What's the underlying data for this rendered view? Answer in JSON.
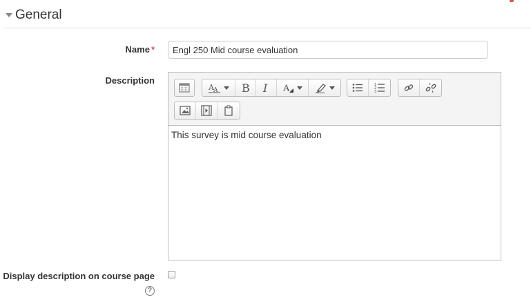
{
  "section": {
    "title": "General"
  },
  "form": {
    "name_label": "Name",
    "required_mark": "*",
    "name_value": "Engl 250 Mid course evaluation",
    "description_label": "Description",
    "description_text": "This survey is mid course evaluation",
    "display_label": "Display description on course page",
    "display_checked": false,
    "help_glyph": "?"
  },
  "toolbar": {
    "row1": [
      {
        "group": [
          {
            "icon": "toolbar-toggle-icon"
          }
        ]
      },
      {
        "group": [
          {
            "icon": "font-style-icon",
            "dropdown": true
          },
          {
            "icon": "bold-icon"
          },
          {
            "icon": "italic-icon"
          },
          {
            "icon": "text-color-icon",
            "dropdown": true
          },
          {
            "icon": "highlight-icon",
            "dropdown": true
          }
        ]
      },
      {
        "group": [
          {
            "icon": "unordered-list-icon"
          },
          {
            "icon": "ordered-list-icon"
          }
        ]
      },
      {
        "group": [
          {
            "icon": "link-icon"
          },
          {
            "icon": "unlink-icon"
          }
        ]
      }
    ],
    "row2": [
      {
        "group": [
          {
            "icon": "image-icon"
          },
          {
            "icon": "media-icon"
          },
          {
            "icon": "paste-icon"
          }
        ]
      }
    ]
  },
  "colors": {
    "required": "#d9534f",
    "label": "#333333",
    "border": "#bbbbbb"
  }
}
